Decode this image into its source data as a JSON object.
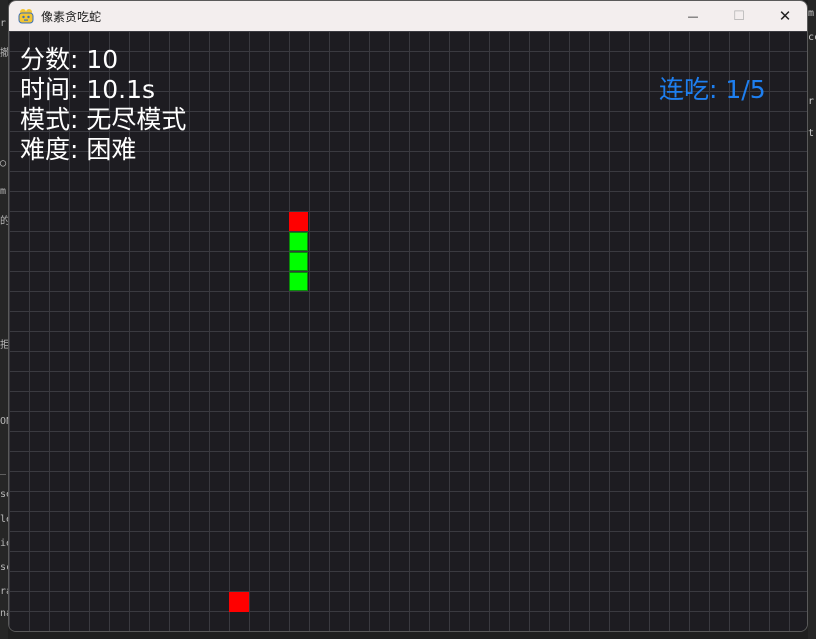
{
  "window": {
    "title": "像素贪吃蛇",
    "minimize_glyph": "—",
    "maximize_glyph": "☐",
    "close_glyph": "✕"
  },
  "hud": {
    "score_text": "分数: 10",
    "time_text": "时间: 10.1s",
    "mode_text": "模式: 无尽模式",
    "difficulty_text": "难度: 困难",
    "combo_text": "连吃: 1/5"
  },
  "colors": {
    "background": "#1d1c21",
    "grid": "#3a3a40",
    "snake_head": "#ff0000",
    "snake_body": "#00ff00",
    "food": "#ff0000",
    "hud_text": "#ffffff",
    "combo_text": "#1e7ff0"
  },
  "background_fragments": {
    "left": [
      "r",
      "撤",
      "◯",
      "m",
      "的",
      "拒",
      "ON",
      "_(",
      "se",
      "le",
      "ie",
      "sc",
      "ra",
      "na"
    ],
    "right": [
      "m",
      "cc",
      "r",
      "t"
    ]
  }
}
